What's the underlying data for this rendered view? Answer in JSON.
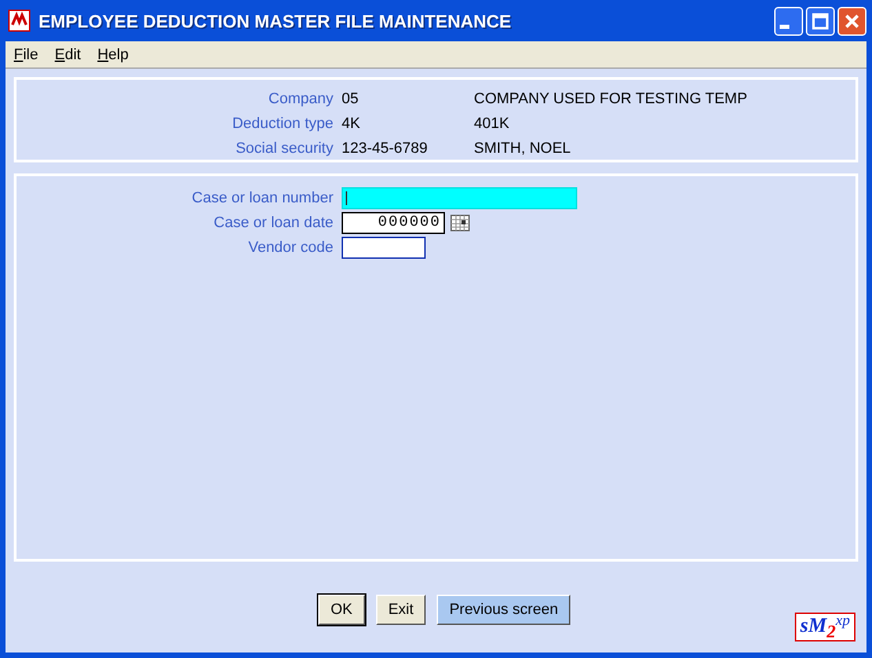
{
  "window": {
    "title": "EMPLOYEE DEDUCTION MASTER FILE MAINTENANCE"
  },
  "menu": [
    {
      "label": "File"
    },
    {
      "label": "Edit"
    },
    {
      "label": "Help"
    }
  ],
  "header_rows": [
    {
      "label": "Company",
      "value": "05",
      "description": "COMPANY USED FOR TESTING TEMP"
    },
    {
      "label": "Deduction type",
      "value": "4K",
      "description": "401K"
    },
    {
      "label": "Social security",
      "value": "123-45-6789",
      "description": "SMITH, NOEL"
    }
  ],
  "fields": [
    {
      "label": "Case or loan number",
      "kind": "text",
      "focused": true
    },
    {
      "label": "Case or loan date",
      "kind": "date",
      "value": "000000",
      "focused": false
    },
    {
      "label": "Vendor code",
      "kind": "short",
      "focused": false
    }
  ],
  "buttons": [
    {
      "label": "OK",
      "default": true
    },
    {
      "label": "Exit",
      "default": false
    },
    {
      "label": "Previous screen",
      "default": false
    }
  ],
  "logo": {
    "first": "s",
    "second": "M",
    "third": "2",
    "fourth": "xp"
  }
}
